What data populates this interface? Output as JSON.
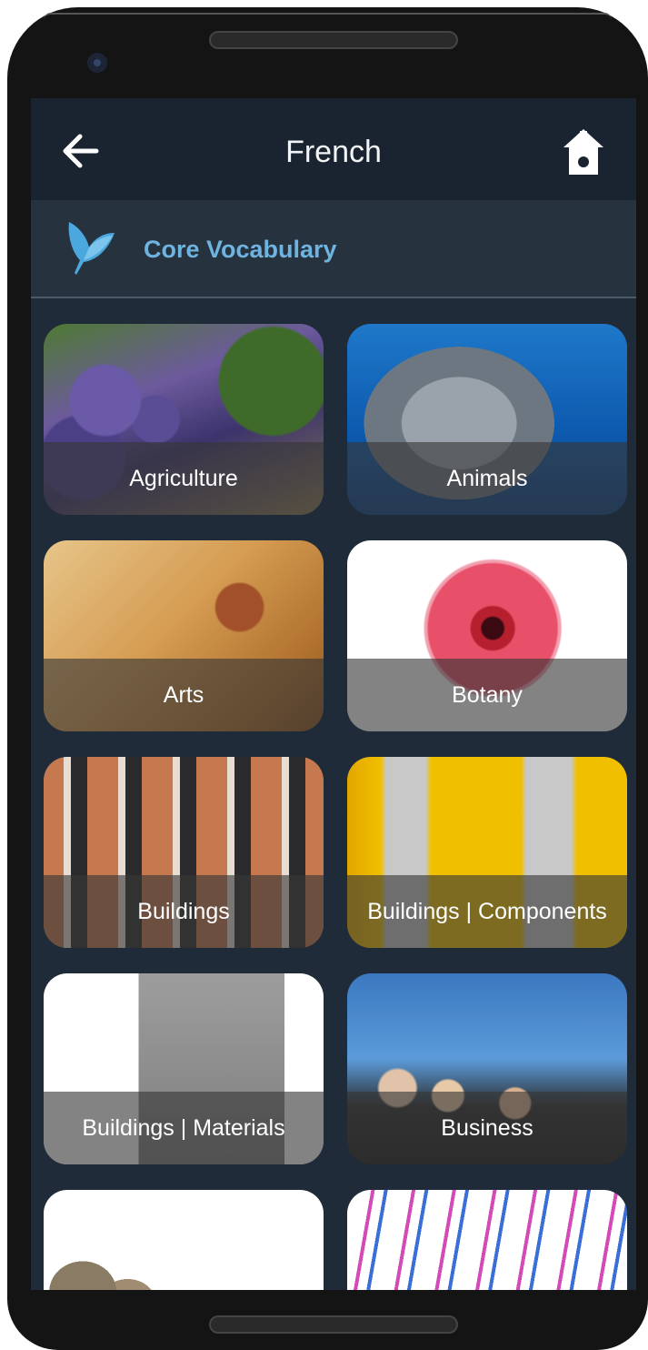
{
  "header": {
    "title": "French",
    "back_icon": "arrow-left-icon",
    "home_icon": "home-icon"
  },
  "subheader": {
    "logo_icon": "bird-logo-icon",
    "title": "Core Vocabulary"
  },
  "categories": [
    {
      "label": "Agriculture"
    },
    {
      "label": "Animals"
    },
    {
      "label": "Arts"
    },
    {
      "label": "Botany"
    },
    {
      "label": "Buildings"
    },
    {
      "label": "Buildings | Components"
    },
    {
      "label": "Buildings | Materials"
    },
    {
      "label": "Business"
    },
    {
      "label": ""
    },
    {
      "label": ""
    }
  ],
  "colors": {
    "background": "#1f2b38",
    "topbar": "#192430",
    "accent": "#6fb3e0"
  }
}
